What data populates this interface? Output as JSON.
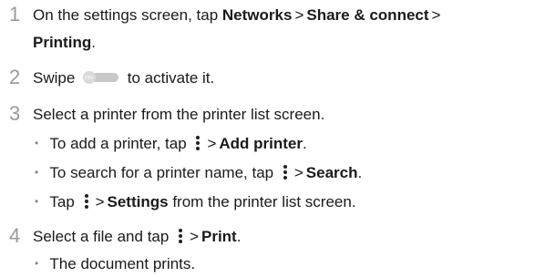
{
  "step1": {
    "num": "1",
    "t1": "On the settings screen, tap ",
    "b1": "Networks",
    "s1": ">",
    "b2": "Share & connect",
    "s2": ">",
    "b3": "Printing",
    "t2": "."
  },
  "step2": {
    "num": "2",
    "t1": "Swipe",
    "toggle_label": "OFF",
    "t2": "to activate it."
  },
  "step3": {
    "num": "3",
    "text": "Select a printer from the printer list screen.",
    "bullets": [
      {
        "t1": "To add a printer, tap",
        "s1": ">",
        "b1": "Add printer",
        "t2": "."
      },
      {
        "t1": "To search for a printer name, tap",
        "s1": ">",
        "b1": "Search",
        "t2": "."
      },
      {
        "t1": "Tap",
        "s1": ">",
        "b1": "Settings",
        "t2": "from the printer list screen."
      }
    ]
  },
  "step4": {
    "num": "4",
    "t1": "Select a file and tap",
    "s1": ">",
    "b1": "Print",
    "t2": ".",
    "bullets": [
      {
        "text": "The document prints."
      }
    ]
  },
  "colors": {
    "text": "#1a1a1a",
    "step_number": "#9a9a9a",
    "bullet": "#888888"
  },
  "icons": {
    "menu": "more-vertical-icon",
    "toggle": "toggle-off-icon"
  }
}
